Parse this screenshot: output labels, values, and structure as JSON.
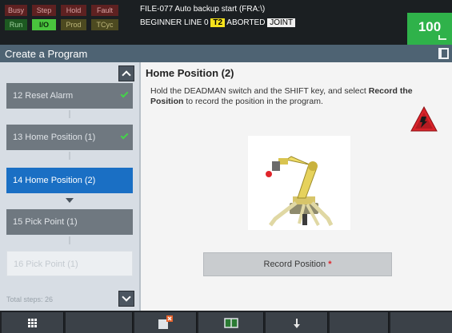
{
  "status": {
    "lamps": {
      "busy": "Busy",
      "step": "Step",
      "hold": "Hold",
      "fault": "Fault",
      "run": "Run",
      "io": "I/O",
      "prod": "Prod",
      "tcyc": "TCyc"
    },
    "alarm_line": "FILE-077 Auto backup start (FRA:\\)",
    "program_line_prefix": "BEGINNER LINE 0",
    "program_tag": "T2",
    "program_state": "ABORTED",
    "coord_tag": "JOINT",
    "override": "100"
  },
  "titlebar": {
    "title": "Create a Program"
  },
  "steps": [
    {
      "label": "12  Reset Alarm",
      "state": "done"
    },
    {
      "label": "13  Home Position (1)",
      "state": "done"
    },
    {
      "label": "14  Home Position (2)",
      "state": "active"
    },
    {
      "label": "15  Pick Point (1)",
      "state": "pending"
    },
    {
      "label": "16  Pick Point (1)",
      "state": "ghost"
    }
  ],
  "total_steps": "Total steps: 26",
  "content": {
    "title": "Home Position (2)",
    "instruction_pre": "Hold the DEADMAN switch and the SHIFT key, and select ",
    "instruction_bold": "Record the Position",
    "instruction_post": " to record the position in the program.",
    "record_button": "Record Position",
    "required_mark": "*"
  },
  "colors": {
    "active_step": "#1a6fc4",
    "override_bg": "#2fb24a",
    "warning": "#d9232a",
    "check": "#45d24a"
  },
  "icons": {
    "scroll_up": "chevron-up-icon",
    "scroll_down": "chevron-down-icon",
    "warning": "warning-triangle-icon",
    "menu": "grid-menu-icon"
  }
}
